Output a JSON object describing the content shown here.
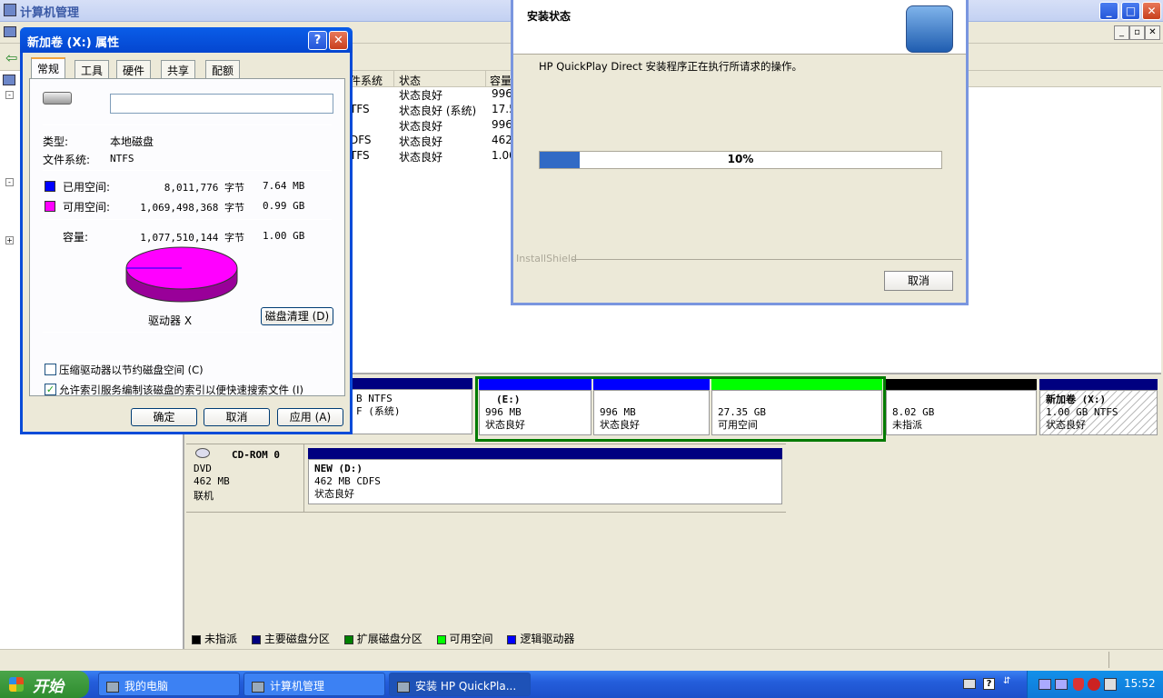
{
  "main_window": {
    "title": "计算机管理"
  },
  "volume_list": {
    "columns": [
      "件系统",
      "状态",
      "容量"
    ],
    "rows": [
      {
        "fs": "",
        "status": "状态良好",
        "capacity": "996"
      },
      {
        "fs": "TFS",
        "status": "状态良好 (系统)",
        "capacity": "17.5"
      },
      {
        "fs": "",
        "status": "状态良好",
        "capacity": "996"
      },
      {
        "fs": "DFS",
        "status": "状态良好",
        "capacity": "462"
      },
      {
        "fs": "TFS",
        "status": "状态良好",
        "capacity": "1.00"
      }
    ]
  },
  "disk0": {
    "partitions": [
      {
        "line1": "B NTFS",
        "line2": "F (系统)"
      },
      {
        "line1": "(E:)",
        "line2": "996 MB",
        "line3": "状态良好"
      },
      {
        "line1": "996 MB",
        "line2": "状态良好"
      },
      {
        "line1": "27.35 GB",
        "line2": "可用空间"
      },
      {
        "line1": "8.02 GB",
        "line2": "未指派"
      },
      {
        "line1": "新加卷  (X:)",
        "line2": "1.00 GB NTFS",
        "line3": "状态良好"
      }
    ]
  },
  "cdrom": {
    "name": "CD-ROM 0",
    "type": "DVD",
    "size": "462 MB",
    "state": "联机",
    "volume_title": "NEW  (D:)",
    "volume_info": "462 MB CDFS",
    "volume_status": "状态良好"
  },
  "legend": [
    {
      "label": "未指派",
      "color": "#000000"
    },
    {
      "label": "主要磁盘分区",
      "color": "#000080"
    },
    {
      "label": "扩展磁盘分区",
      "color": "#008000"
    },
    {
      "label": "可用空间",
      "color": "#00ff00"
    },
    {
      "label": "逻辑驱动器",
      "color": "#0000ff"
    }
  ],
  "props_dialog": {
    "title": "新加卷 (X:) 属性",
    "help": "?",
    "close": "✕",
    "tabs": [
      "常规",
      "工具",
      "硬件",
      "共享",
      "配额"
    ],
    "volume_name": "",
    "type_label": "类型:",
    "type_value": "本地磁盘",
    "fs_label": "文件系统:",
    "fs_value": "NTFS",
    "used_label": "已用空间:",
    "used_bytes": "8,011,776 字节",
    "used_size": "7.64 MB",
    "free_label": "可用空间:",
    "free_bytes": "1,069,498,368 字节",
    "free_size": "0.99 GB",
    "cap_label": "容量:",
    "cap_bytes": "1,077,510,144 字节",
    "cap_size": "1.00 GB",
    "drive_label": "驱动器 X",
    "cleanup_button": "磁盘清理 (D)",
    "compress_label": "压缩驱动器以节约磁盘空间 (C)",
    "compress_checked": false,
    "index_label": "允许索引服务编制该磁盘的索引以便快速搜索文件 (I)",
    "index_checked": true,
    "ok_button": "确定",
    "cancel_button": "取消",
    "apply_button": "应用 (A)",
    "used_color": "#0000ff",
    "free_color": "#ff00ff",
    "used_fraction": 0.0074
  },
  "install_dialog": {
    "title": "安装状态",
    "message": "HP QuickPlay Direct 安装程序正在执行所请求的操作。",
    "progress_text": "10%",
    "progress": 0.1,
    "brand": "InstallShield",
    "cancel_button": "取消"
  },
  "taskbar": {
    "start_label": "开始",
    "tasks": [
      {
        "label": "我的电脑"
      },
      {
        "label": "计算机管理"
      },
      {
        "label": "安装 HP QuickPla..."
      }
    ],
    "clock": "15:52"
  }
}
